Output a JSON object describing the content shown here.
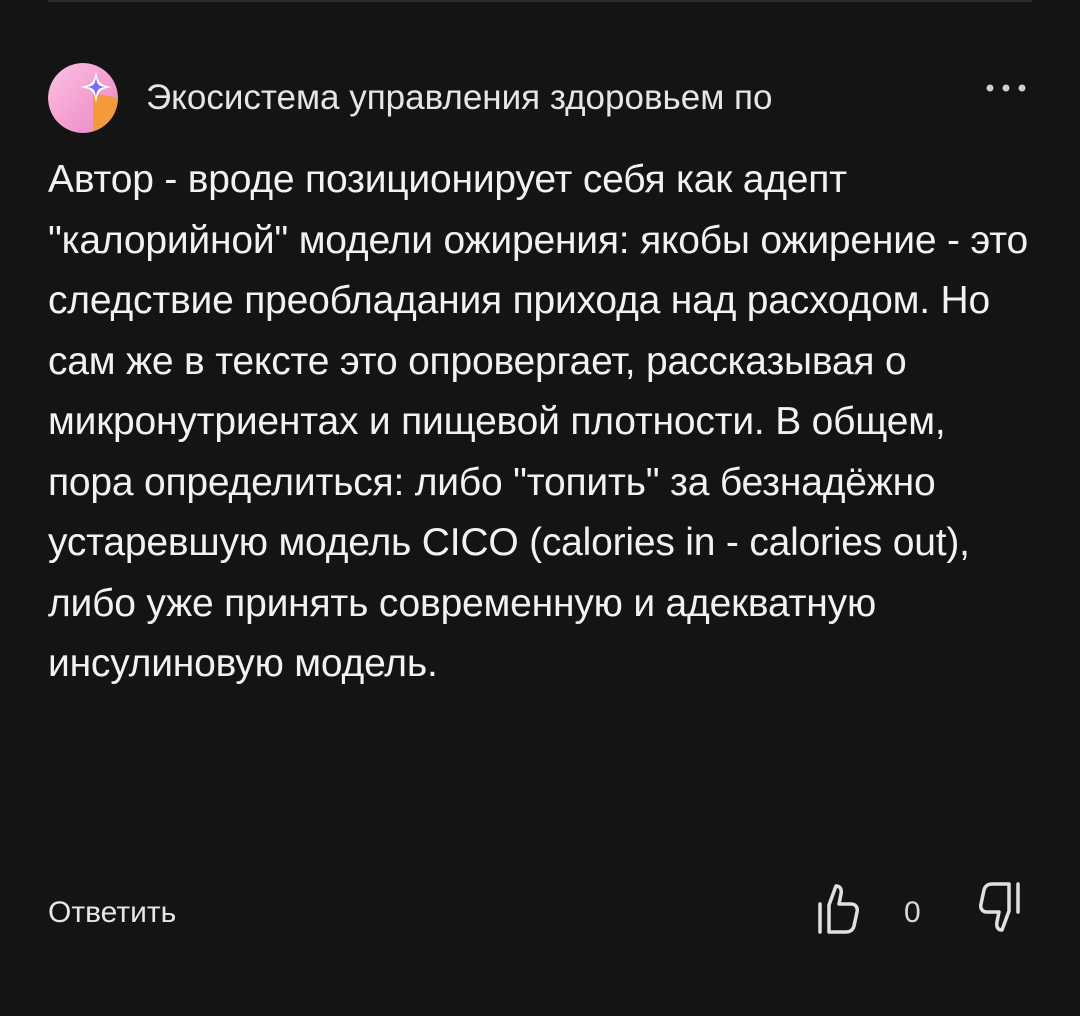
{
  "comment": {
    "author": "Экосистема управления здоровьем по",
    "text": "Автор - вроде позиционирует себя как адепт \"калорийной\" модели ожирения: якобы ожирение - это следствие преобладания прихода над расходом. Но сам же в тексте это опровергает, рассказывая о микронутриентах и пищевой плотности. В общем, пора определиться: либо \"топить\" за безнадёжно устаревшую модель CICO (calories in - calories out), либо уже принять современную и адекватную инсулиновую модель.",
    "reply_label": "Ответить",
    "like_count": "0"
  },
  "icons": {
    "avatar": "gradient-star-avatar",
    "more": "more-dots-icon",
    "like": "thumbs-up-icon",
    "dislike": "thumbs-down-icon"
  },
  "colors": {
    "background": "#141414",
    "text": "#f2f2f2",
    "avatar_pink": "#f7a8d8",
    "avatar_orange": "#f39a3c",
    "avatar_violet": "#7b6cf6"
  }
}
